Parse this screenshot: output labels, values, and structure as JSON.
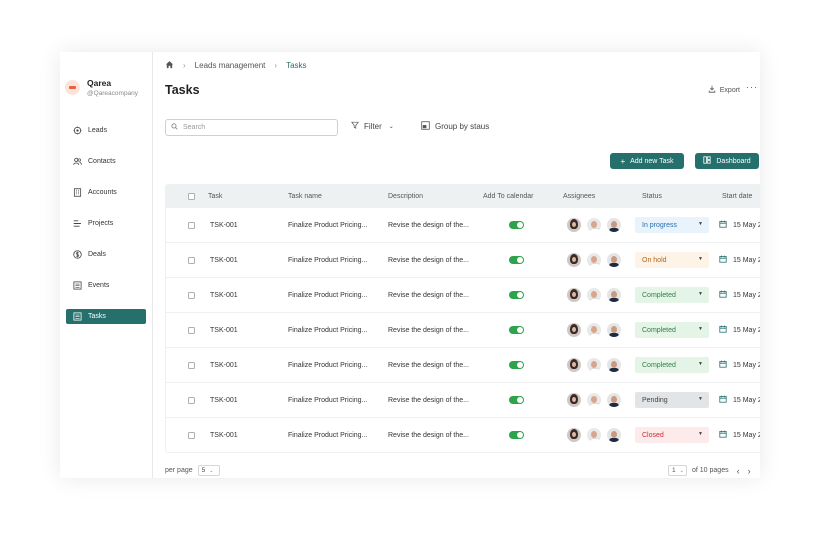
{
  "profile": {
    "name": "Qarea",
    "handle": "@Qareacompany"
  },
  "sidebar": {
    "items": [
      {
        "label": "Leads",
        "icon": "target-icon",
        "active": false
      },
      {
        "label": "Contacts",
        "icon": "contacts-icon",
        "active": false
      },
      {
        "label": "Accounts",
        "icon": "building-icon",
        "active": false
      },
      {
        "label": "Projects",
        "icon": "projects-icon",
        "active": false
      },
      {
        "label": "Deals",
        "icon": "dollar-icon",
        "active": false
      },
      {
        "label": "Events",
        "icon": "events-icon",
        "active": false
      },
      {
        "label": "Tasks",
        "icon": "tasks-icon",
        "active": true
      }
    ]
  },
  "breadcrumb": {
    "home_icon": "home-icon",
    "parent": "Leads management",
    "current": "Tasks"
  },
  "page": {
    "title": "Tasks",
    "export_label": "Export",
    "more_label": "···"
  },
  "toolbar": {
    "search_placeholder": "Search",
    "filter_label": "Filter",
    "group_label": "Group by staus",
    "add_label": "Add new Task",
    "dashboard_label": "Dashboard"
  },
  "table": {
    "columns": [
      "Task",
      "Task name",
      "Description",
      "Add To calendar",
      "Assignees",
      "Status",
      "Start date"
    ],
    "rows": [
      {
        "id": "TSK-001",
        "name": "Finalize Product Pricing...",
        "desc": "Revise the design of the...",
        "calendar": true,
        "status": "In progress",
        "date": "15 May 2"
      },
      {
        "id": "TSK-001",
        "name": "Finalize Product Pricing...",
        "desc": "Revise the design of the...",
        "calendar": true,
        "status": "On hold",
        "date": "15 May 2"
      },
      {
        "id": "TSK-001",
        "name": "Finalize Product Pricing...",
        "desc": "Revise the design of the...",
        "calendar": true,
        "status": "Completed",
        "date": "15 May 2"
      },
      {
        "id": "TSK-001",
        "name": "Finalize Product Pricing...",
        "desc": "Revise the design of the...",
        "calendar": true,
        "status": "Completed",
        "date": "15 May 2"
      },
      {
        "id": "TSK-001",
        "name": "Finalize Product Pricing...",
        "desc": "Revise the design of the...",
        "calendar": true,
        "status": "Completed",
        "date": "15 May 2"
      },
      {
        "id": "TSK-001",
        "name": "Finalize Product Pricing...",
        "desc": "Revise the design of the...",
        "calendar": true,
        "status": "Pending",
        "date": "15 May 2"
      },
      {
        "id": "TSK-001",
        "name": "Finalize Product Pricing...",
        "desc": "Revise the design of the...",
        "calendar": true,
        "status": "Closed",
        "date": "15 May 2"
      }
    ]
  },
  "status_colors": {
    "In progress": {
      "bg": "#e8f3fb",
      "fg": "#2b6fae"
    },
    "On hold": {
      "bg": "#fdf3e6",
      "fg": "#b5651d"
    },
    "Completed": {
      "bg": "#e4f5e8",
      "fg": "#2e7d43"
    },
    "Pending": {
      "bg": "#e2e4e6",
      "fg": "#444444"
    },
    "Closed": {
      "bg": "#fdeaea",
      "fg": "#c53030"
    }
  },
  "pagination": {
    "per_page_label": "per page",
    "per_page": "5",
    "page": "1",
    "of_pages": "of 10 pages"
  },
  "colors": {
    "accent": "#25706c",
    "toggle_on": "#2fa34a"
  }
}
